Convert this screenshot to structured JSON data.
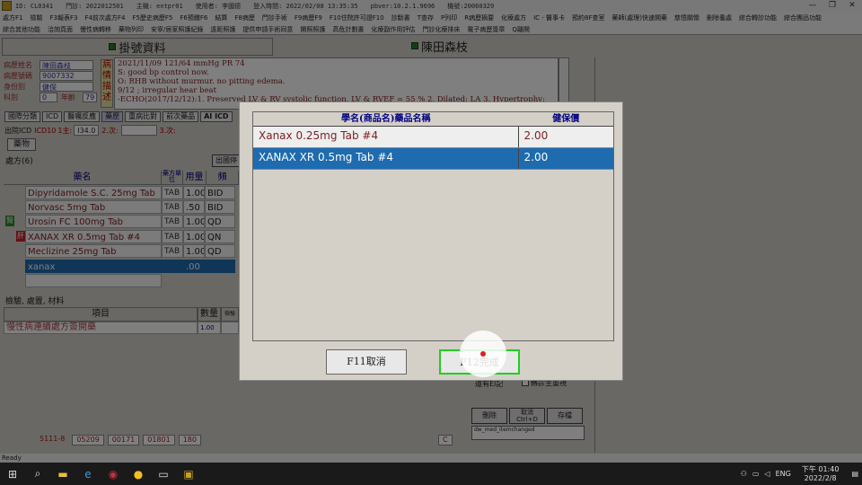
{
  "titlebar": {
    "items": [
      "ID: CL0341",
      "門診: 2022012501",
      "主機: entpr01",
      "使用者: 李國德",
      "登入時間: 2022/02/08 13:35:35",
      "pbver:10.2.1.9696",
      "機號:20060329"
    ]
  },
  "menu": {
    "row1": [
      "處方F1",
      "檢驗",
      "F3報表F3",
      "F4前次處方F4",
      "F5歷史病歷F5",
      "F6預繳F6",
      "結算",
      "F8病歷",
      "門診手術",
      "F9病歷F9",
      "F10住院許可證F10",
      "診斷書",
      "T查存",
      "P列印",
      "R病歷摘要",
      "化療處方",
      "IC - 醫事卡",
      "預約8F查室",
      "藥師(處理)快速開藥",
      "慈悟關懷",
      "刪除養處",
      "綜合轉診功能",
      "綜合團品功能"
    ],
    "row2": [
      "綜合其他功能",
      "洽詢頁面",
      "慢性病轉移",
      "藥物列印",
      "安寧/居家照護紀錄",
      "遠距照護",
      "提供申請手術同意",
      "開照照護",
      "高危計劃書",
      "化療副作用評估",
      "門診化療排床",
      "電子病歷簽章",
      "Q離開"
    ]
  },
  "header": {
    "left_title": "掛號資料",
    "right_title": "陳田森枝"
  },
  "patient": {
    "name_label": "病歷姓名",
    "name": "陳田森枝",
    "id_label": "病歷號碼",
    "id": "9007332",
    "type_label": "身份別",
    "type": "健保",
    "dept_label": "科別",
    "dept": "0",
    "age_label": "年齡",
    "age": "79"
  },
  "side_label": "病情描述",
  "notes": [
    "2021/11/09  121/64 mmHg PR 74",
    "S: good bp control now.",
    "O: RHB without murmur. no pitting edema.",
    "    9/12 ; irregular hear beat",
    "-ECHO(2017/12/12):1. Preserved LV & RV systolic function, LV & RVEF = 55 % 2. Dilated: LA 3. Hypertrophy:"
  ],
  "tabs": [
    "國際分類",
    "ICD",
    "醫囑反應",
    "藥歷",
    "重病比對",
    "前次藥品",
    "AI ICD"
  ],
  "icd": {
    "label": "出院ICD",
    "code_label": "ICD10",
    "main": "1主:",
    "main_value": "I34.0",
    "second": "2.次:",
    "third": "3.次:"
  },
  "drug_button": "藥物",
  "rx": {
    "label": "處方(6)",
    "outside_label": "出國停",
    "headers": {
      "name": "藥名",
      "unit": "藥方單位",
      "qty": "用量",
      "freq": "頻"
    },
    "rows": [
      {
        "name": "Dipyridamole S.C. 25mg Tab",
        "unit": "TAB",
        "qty": "1.00",
        "freq": "BID"
      },
      {
        "name": "Norvasc 5mg Tab",
        "unit": "TAB",
        "qty": ".50",
        "freq": "BID"
      },
      {
        "name": "Urosin FC 100mg Tab",
        "unit": "TAB",
        "qty": "1.00",
        "freq": "QD"
      },
      {
        "name": "XANAX XR 0.5mg Tab #4",
        "unit": "TAB",
        "qty": "1.00",
        "freq": "QN"
      },
      {
        "name": "Meclizine 25mg Tab",
        "unit": "TAB",
        "qty": "1.00",
        "freq": "QD"
      },
      {
        "name": "xanax",
        "unit": "",
        "qty": ".00",
        "freq": ""
      }
    ],
    "badge_green": "腎",
    "badge_red": "肝"
  },
  "exam": {
    "label": "檢驗, 處置, 材料",
    "headers": {
      "item": "項目",
      "qty": "數量",
      "extra": "檢驗"
    },
    "row": {
      "item": "慢性病連續處方簽開藥",
      "qty": "1.00"
    }
  },
  "footer": [
    "5111-8",
    "05209",
    "00171",
    "01801",
    "180",
    "C"
  ],
  "bottom_right": {
    "label": "還有EI記",
    "check_label": "轉診主重視",
    "btn1": "刪除",
    "btn2": "取消 Ctrl+D",
    "btn3": "存檔",
    "status_text": "dw_med_itemchanged"
  },
  "statusbar": "Ready",
  "dialog": {
    "col1": "學名(商品名)藥品名稱",
    "col2": "健保價",
    "rows": [
      {
        "name": "Xanax 0.25mg Tab #4",
        "price": "2.00"
      },
      {
        "name": "XANAX XR 0.5mg Tab #4",
        "price": "2.00"
      }
    ],
    "cancel": "F11取消",
    "ok": "F12完成"
  },
  "taskbar": {
    "lang": "ENG",
    "time": "下午 01:40",
    "date": "2022/2/8"
  }
}
